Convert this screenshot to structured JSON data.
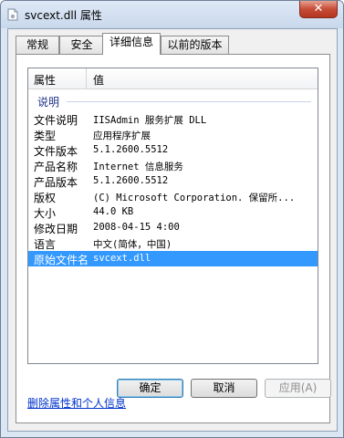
{
  "window": {
    "title": "svcext.dll 属性",
    "close_symbol": "✕",
    "icon": "file-icon"
  },
  "tabs": [
    {
      "label": "常规",
      "active": false
    },
    {
      "label": "安全",
      "active": false
    },
    {
      "label": "详细信息",
      "active": true
    },
    {
      "label": "以前的版本",
      "active": false
    }
  ],
  "list": {
    "headers": {
      "property": "属性",
      "value": "值"
    },
    "group": "说明",
    "rows": [
      {
        "name": "文件说明",
        "value": "IISAdmin 服务扩展 DLL"
      },
      {
        "name": "类型",
        "value": "应用程序扩展"
      },
      {
        "name": "文件版本",
        "value": "5.1.2600.5512"
      },
      {
        "name": "产品名称",
        "value": "Internet 信息服务"
      },
      {
        "name": "产品版本",
        "value": "5.1.2600.5512"
      },
      {
        "name": "版权",
        "value": "(C) Microsoft Corporation. 保留所..."
      },
      {
        "name": "大小",
        "value": "44.0 KB"
      },
      {
        "name": "修改日期",
        "value": "2008-04-15 4:00"
      },
      {
        "name": "语言",
        "value": "中文(简体，中国)"
      },
      {
        "name": "原始文件名",
        "value": "svcext.dll",
        "selected": true
      }
    ]
  },
  "remove_link": "删除属性和个人信息",
  "buttons": {
    "ok": "确定",
    "cancel": "取消",
    "apply": "应用(A)"
  },
  "colors": {
    "selection": "#3399ff",
    "link": "#0033cc",
    "group_label": "#1e3287"
  }
}
